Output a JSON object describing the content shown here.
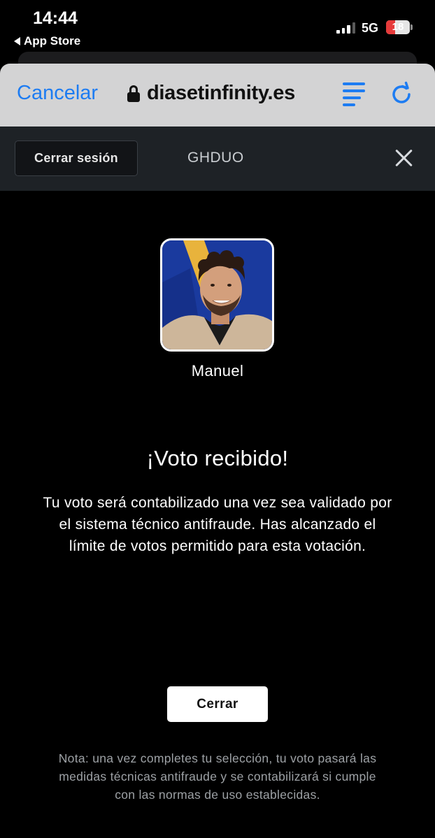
{
  "status_bar": {
    "time": "14:44",
    "back_app": "App Store",
    "network": "5G",
    "battery": "18",
    "battery_level": 0.18
  },
  "browser": {
    "cancel_label": "Cancelar",
    "url": "diasetinfinity.es",
    "accent_color": "#1d7cf2"
  },
  "header": {
    "logout_label": "Cerrar sesión",
    "program_code": "GHDUO"
  },
  "contestant": {
    "name": "Manuel"
  },
  "result": {
    "title": "¡Voto recibido!",
    "message": "Tu voto será contabilizado una vez sea validado por el sistema técnico antifraude. Has alcanzado el límite de votos permitido para esta votación.",
    "close_label": "Cerrar",
    "note": "Nota: una vez completes tu selección, tu voto pasará las medidas técnicas antifraude y se contabilizará si cumple con las normas de uso establecidas."
  }
}
